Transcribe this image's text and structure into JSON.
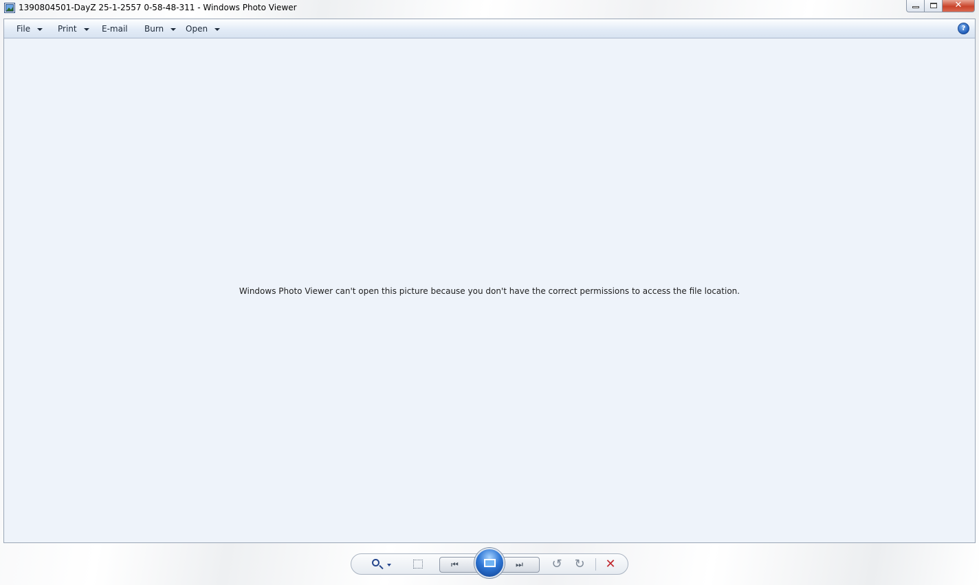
{
  "window": {
    "title": "1390804501-DayZ 25-1-2557 0-58-48-311 - Windows Photo Viewer",
    "app_icon": "photo-viewer-icon",
    "controls": {
      "close_glyph": "✕"
    }
  },
  "menu": {
    "items": [
      {
        "label": "File",
        "has_dropdown": true
      },
      {
        "label": "Print",
        "has_dropdown": true
      },
      {
        "label": "E-mail",
        "has_dropdown": false
      },
      {
        "label": "Burn",
        "has_dropdown": true
      },
      {
        "label": "Open",
        "has_dropdown": true
      }
    ],
    "help_glyph": "?"
  },
  "viewer": {
    "message": "Windows Photo Viewer can't open this picture because you don't have the correct permissions to access the file location."
  },
  "controls": {
    "icons": [
      "zoom-icon",
      "actual-size-icon",
      "previous-icon",
      "slideshow-icon",
      "next-icon",
      "rotate-left-icon",
      "rotate-right-icon",
      "delete-icon"
    ],
    "prev_glyph": "⏮",
    "next_glyph": "⏭",
    "rotate_left_glyph": "↺",
    "rotate_right_glyph": "↻",
    "delete_glyph": "✕"
  },
  "colors": {
    "viewer_background": "#eef3fa",
    "delete_red": "#c0272d",
    "slideshow_blue": "#2f77d6"
  }
}
